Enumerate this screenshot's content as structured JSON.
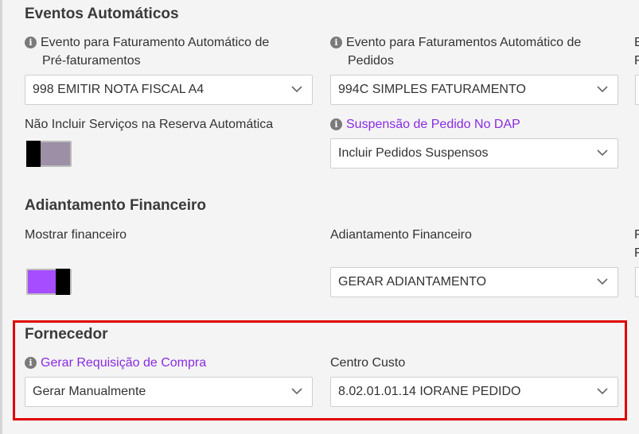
{
  "eventos": {
    "title": "Eventos Automáticos",
    "faturamento_pre": {
      "label_line1": "Evento para Faturamento Automático de",
      "label_line2": "Pré-faturamentos",
      "value": "998 EMITIR NOTA FISCAL A4"
    },
    "faturamento_pedidos": {
      "label_line1": "Evento para Faturamentos Automático de",
      "label_line2": "Pedidos",
      "value": "994C SIMPLES FATURAMENTO"
    },
    "nao_incluir_servicos": {
      "label": "Não Incluir Serviços na Reserva Automática",
      "toggle_on": false
    },
    "suspensao_pedido": {
      "label": "Suspensão de Pedido No DAP",
      "value": "Incluir Pedidos Suspensos"
    }
  },
  "adiantamento": {
    "title": "Adiantamento Financeiro",
    "mostrar_financeiro": {
      "label": "Mostrar financeiro",
      "toggle_on": true
    },
    "adiantamento_financeiro": {
      "label": "Adiantamento Financeiro",
      "value": "GERAR ADIANTAMENTO"
    }
  },
  "fornecedor": {
    "title": "Fornecedor",
    "gerar_requisicao": {
      "label": "Gerar Requisição de Compra",
      "value": "Gerar Manualmente"
    },
    "centro_custo": {
      "label": "Centro Custo",
      "value": "8.02.01.01.14 IORANE PEDIDO"
    }
  },
  "colors": {
    "accent": "#8a2be2",
    "toggle_on": "#a64dff",
    "toggle_off": "#9d8fa5",
    "highlight": "#e00000"
  }
}
